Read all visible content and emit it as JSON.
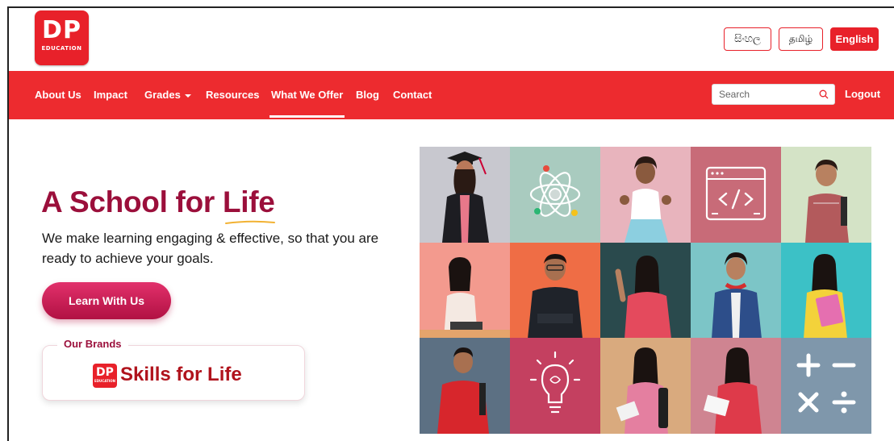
{
  "logo": {
    "big": "DP",
    "small": "EDUCATION"
  },
  "languages": [
    {
      "label": "සිංහල",
      "active": false
    },
    {
      "label": "தமிழ்",
      "active": false
    },
    {
      "label": "English",
      "active": true
    }
  ],
  "nav": {
    "items": [
      "About Us",
      "Impact",
      "Grades",
      "Resources",
      "What We Offer",
      "Blog",
      "Contact"
    ],
    "active": "What We Offer",
    "search_placeholder": "Search",
    "logout": "Logout"
  },
  "hero": {
    "headline": "A School for Life",
    "subtitle": "We make learning engaging & effective, so that you are ready to achieve your goals.",
    "cta": "Learn With Us",
    "brands_label": "Our Brands",
    "brand_logo": {
      "big": "DP",
      "small": "EDUCATION"
    },
    "brand_name": "Skills for Life"
  },
  "colors": {
    "brand_red": "#ed2b2f",
    "headline_maroon": "#9b0f3b",
    "cta_pink": "#c81d55"
  },
  "grid_tiles": [
    {
      "name": "graduate-girl",
      "bg": "#c8c8cf"
    },
    {
      "name": "atom-icon",
      "bg": "#a9cbbf"
    },
    {
      "name": "thumbs-up-girl",
      "bg": "#e8b4bd"
    },
    {
      "name": "code-icon",
      "bg": "#c86b78"
    },
    {
      "name": "schoolboy",
      "bg": "#d4e3c6"
    },
    {
      "name": "girl-with-tablet",
      "bg": "#f39a8e"
    },
    {
      "name": "boy-in-shirt",
      "bg": "#ef6d45"
    },
    {
      "name": "pointing-woman",
      "bg": "#2a4a4d"
    },
    {
      "name": "boy-with-headphones",
      "bg": "#7cc5c7"
    },
    {
      "name": "girl-with-books",
      "bg": "#3cc1c6"
    },
    {
      "name": "man-in-red-shirt",
      "bg": "#5c7083"
    },
    {
      "name": "idea-bulb-icon",
      "bg": "#c44060"
    },
    {
      "name": "woman-with-bag",
      "bg": "#d9aa7e"
    },
    {
      "name": "girl-with-paper",
      "bg": "#cf8491"
    },
    {
      "name": "math-symbols-icon",
      "bg": "#7f97ab"
    }
  ]
}
